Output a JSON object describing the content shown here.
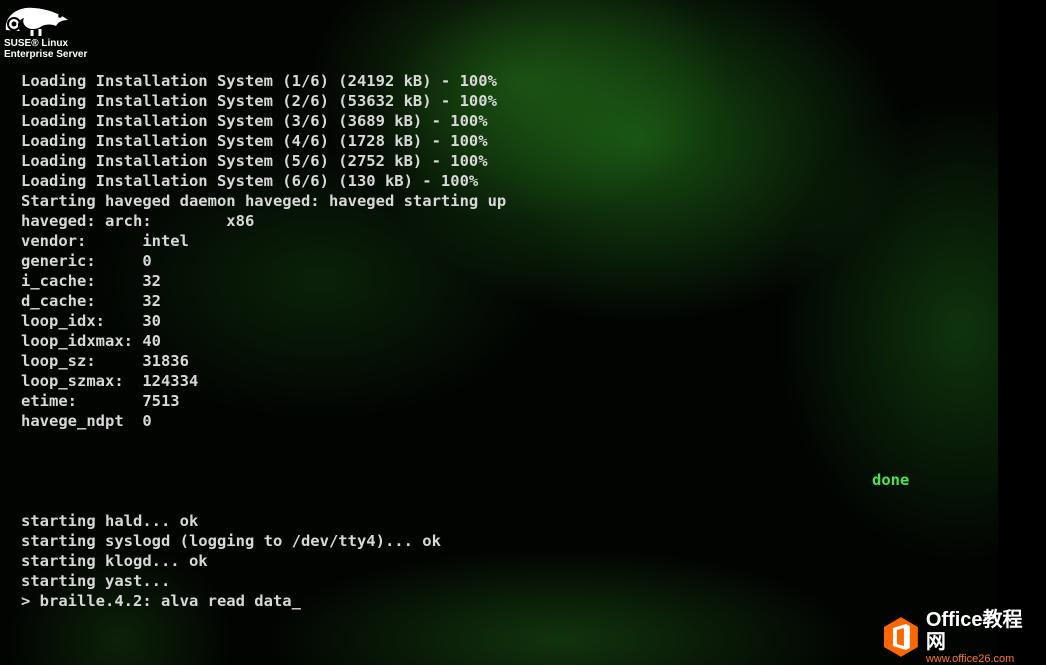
{
  "branding": {
    "logo_icon": "suse-chameleon-icon",
    "brand_line1": "SUSE® Linux",
    "brand_line2": "Enterprise Server"
  },
  "console": {
    "lines": [
      "Loading Installation System (1/6) (24192 kB) - 100%",
      "Loading Installation System (2/6) (53632 kB) - 100%",
      "Loading Installation System (3/6) (3689 kB) - 100%",
      "Loading Installation System (4/6) (1728 kB) - 100%",
      "Loading Installation System (5/6) (2752 kB) - 100%",
      "Loading Installation System (6/6) (130 kB) - 100%",
      "Starting haveged daemon haveged: haveged starting up",
      "haveged: arch:        x86",
      "vendor:      intel",
      "generic:     0",
      "i_cache:     32",
      "d_cache:     32",
      "loop_idx:    30",
      "loop_idxmax: 40",
      "loop_sz:     31836",
      "loop_szmax:  124334",
      "etime:       7513",
      "havege_ndpt  0"
    ],
    "status_done": "done",
    "lines_after": [
      "starting hald... ok",
      "starting syslogd (logging to /dev/tty4)... ok",
      "starting klogd... ok",
      "starting yast...",
      "> braille.4.2: alva read data_"
    ]
  },
  "watermark": {
    "icon": "office-logo-icon",
    "title": "Office教程网",
    "url": "www.office26.com",
    "accent": "#ff6600"
  }
}
